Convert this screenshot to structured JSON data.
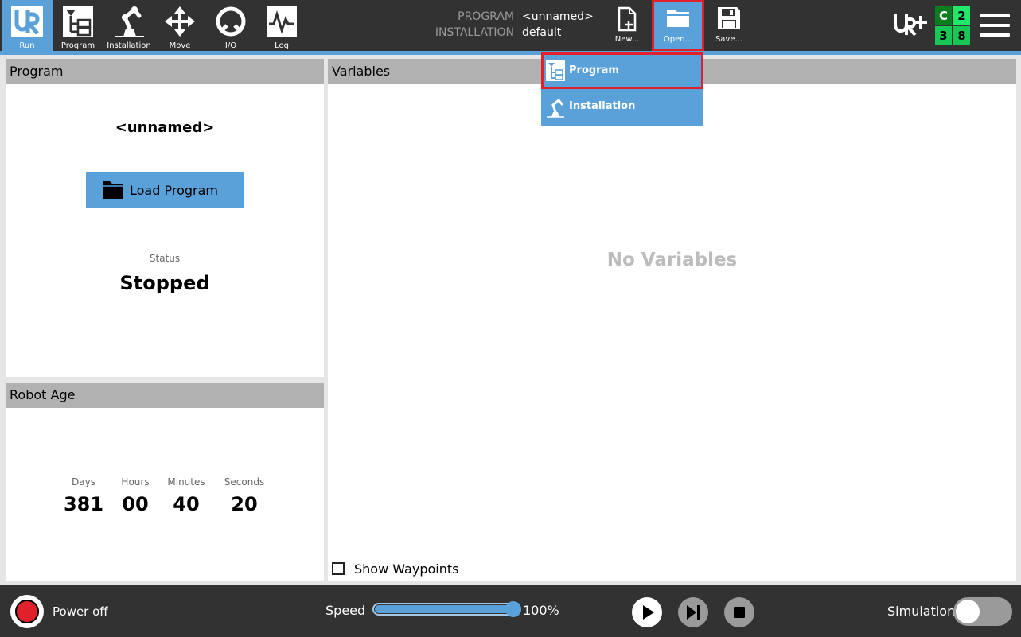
{
  "nav": {
    "items": [
      {
        "id": "run",
        "label": "Run",
        "icon": "ur-logo-icon",
        "active": true
      },
      {
        "id": "program",
        "label": "Program",
        "icon": "program-tree-icon"
      },
      {
        "id": "installation",
        "label": "Installation",
        "icon": "robot-arm-icon"
      },
      {
        "id": "move",
        "label": "Move",
        "icon": "move-arrows-icon"
      },
      {
        "id": "io",
        "label": "I/O",
        "icon": "io-icon"
      },
      {
        "id": "log",
        "label": "Log",
        "icon": "log-icon"
      }
    ]
  },
  "program_info": {
    "program_label": "PROGRAM",
    "program_value": "<unnamed>",
    "installation_label": "INSTALLATION",
    "installation_value": "default"
  },
  "file_buttons": {
    "new_label": "New...",
    "open_label": "Open...",
    "save_label": "Save..."
  },
  "status_grid": [
    "C",
    "2",
    "3",
    "8"
  ],
  "open_menu": {
    "items": [
      {
        "label": "Program",
        "icon": "program-tree-icon",
        "highlighted": true
      },
      {
        "label": "Installation",
        "icon": "robot-arm-icon"
      }
    ]
  },
  "program_panel": {
    "title": "Program",
    "program_name": "<unnamed>",
    "load_button": "Load Program",
    "status_label": "Status",
    "status_value": "Stopped"
  },
  "robot_age": {
    "title": "Robot Age",
    "days_label": "Days",
    "days": "381",
    "hours_label": "Hours",
    "hours": "00",
    "minutes_label": "Minutes",
    "minutes": "40",
    "seconds_label": "Seconds",
    "seconds": "20"
  },
  "variables_panel": {
    "title": "Variables",
    "empty_text": "No Variables",
    "show_waypoints_label": "Show Waypoints",
    "show_waypoints_checked": false
  },
  "footer": {
    "power_label": "Power off",
    "speed_label": "Speed",
    "speed_value": "100%",
    "speed_fraction": 1.0,
    "simulation_label": "Simulation",
    "simulation_on": false
  },
  "colors": {
    "header_bg": "#323232",
    "accent_blue": "#5aa1d9",
    "highlight_red": "#e0202a",
    "status_green": "#1fe86a"
  }
}
